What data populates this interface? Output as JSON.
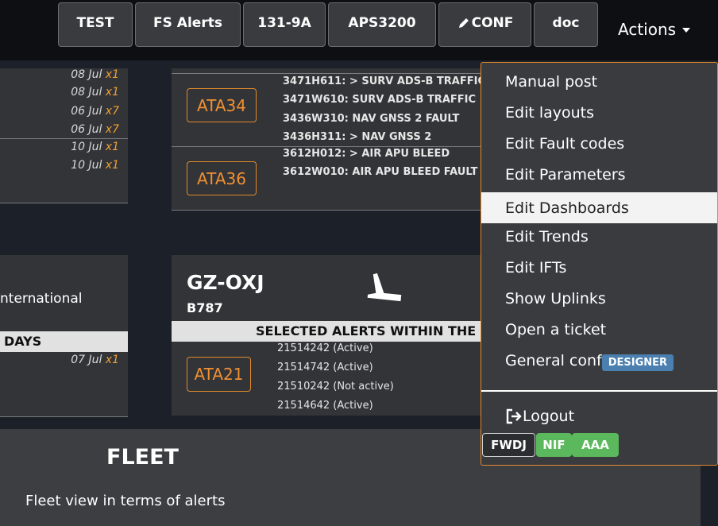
{
  "nav": {
    "buttons": [
      "TEST",
      "FS Alerts",
      "131-9A",
      "APS3200",
      "CONF",
      "doc"
    ],
    "actions_label": "Actions"
  },
  "top_left_card": {
    "dates": [
      {
        "date": "08 Jul",
        "mult": "x1"
      },
      {
        "date": "08 Jul",
        "mult": "x1"
      },
      {
        "date": "06 Jul",
        "mult": "x7"
      },
      {
        "date": "06 Jul",
        "mult": "x7"
      },
      {
        "date": "10 Jul",
        "mult": "x1"
      },
      {
        "date": "10 Jul",
        "mult": "x1"
      }
    ]
  },
  "top_right_card": {
    "groups": [
      {
        "ata": "ATA34",
        "faults": [
          "3471H611: > SURV ADS-B TRAFFIC",
          "3471W610: SURV ADS-B TRAFFIC",
          "3436W310: NAV GNSS 2 FAULT",
          "3436H311: > NAV GNSS 2"
        ]
      },
      {
        "ata": "ATA36",
        "faults": [
          "3612H012: > AIR APU BLEED",
          "3612W010: AIR APU BLEED FAULT"
        ]
      }
    ]
  },
  "bottom_left_card": {
    "location": "nternational",
    "strip": "DAYS",
    "dates": [
      {
        "date": "07 Jul",
        "mult": "x1"
      }
    ]
  },
  "aircraft_card": {
    "tail": "GZ-OXJ",
    "model": "B787",
    "strip": "SELECTED ALERTS WITHIN THE",
    "ata": "ATA21",
    "alerts": [
      "21514242 (Active)",
      "21514742 (Active)",
      "21510242 (Not active)",
      "21514642 (Active)"
    ]
  },
  "fleet": {
    "title": "FLEET",
    "subtitle": "Fleet view in terms of alerts"
  },
  "menu": {
    "items": [
      "Manual post",
      "Edit layouts",
      "Edit Fault codes",
      "Edit Parameters",
      "Edit Dashboards",
      "Edit Trends",
      "Edit IFTs",
      "Show Uplinks",
      "Open a ticket"
    ],
    "general_conf": "General conf",
    "designer_badge": "DESIGNER",
    "logout": "Logout",
    "tags": [
      "FWDJ",
      "NIF",
      "AAA"
    ]
  },
  "colors": {
    "accent_orange": "#e08a2a",
    "tag_green": "#5cb85c",
    "badge_blue": "#4a7fb0"
  }
}
